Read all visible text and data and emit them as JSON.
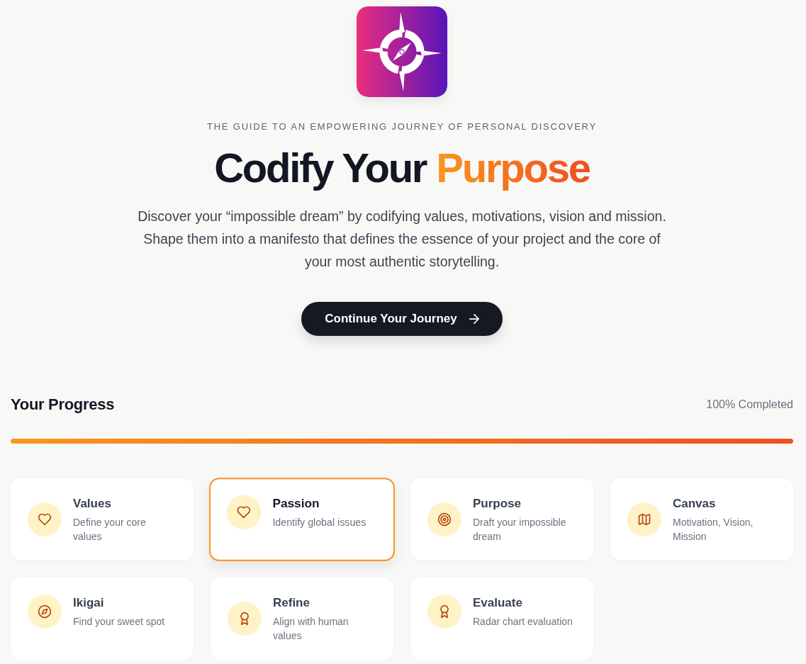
{
  "hero": {
    "eyebrow": "THE GUIDE TO AN EMPOWERING JOURNEY OF PERSONAL DISCOVERY",
    "title": "Codify Your **Purpose**",
    "description": "Discover your “impossible dream” by codifying values, motivations, vision and mission. Shape them into a manifesto that defines the essence of your project and the core of your most authentic storytelling.",
    "button": "Continue Your Journey"
  },
  "progress": {
    "title": "Your Progress",
    "status": "100% Completed",
    "level": 1
  },
  "steps": [
    {
      "title": "Values",
      "description": "Define your core values",
      "selected": false
    },
    {
      "title": "Passion",
      "description": "Identify global issues",
      "selected": true
    },
    {
      "title": "Purpose",
      "description": "Draft your impossible dream",
      "selected": false
    },
    {
      "title": "Canvas",
      "description": "Motivation, Vision, Mission",
      "selected": false
    },
    {
      "title": "Ikigai",
      "description": "Find your sweet spot",
      "selected": false
    },
    {
      "title": "Refine",
      "description": "Align with human values",
      "selected": false
    },
    {
      "title": "Evaluate",
      "description": "Radar chart evaluation",
      "selected": false
    }
  ]
}
